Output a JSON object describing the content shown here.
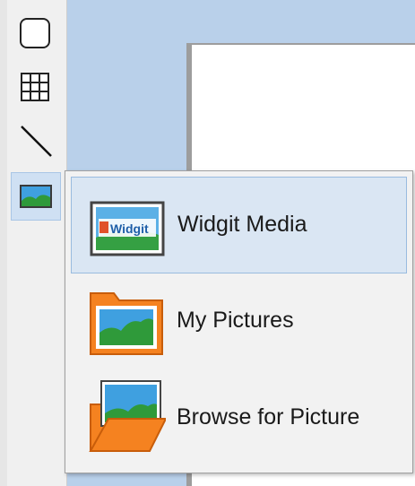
{
  "window": {
    "title": ""
  },
  "toolbar": {
    "tools": [
      {
        "name": "rounded-rectangle",
        "icon": "rounded-square-icon"
      },
      {
        "name": "table",
        "icon": "grid-icon"
      },
      {
        "name": "line",
        "icon": "line-icon"
      },
      {
        "name": "picture",
        "icon": "picture-icon",
        "selected": true
      }
    ]
  },
  "popup": {
    "items": [
      {
        "label": "Widgit Media",
        "icon": "widgit-media-icon",
        "badge": "Widgit",
        "highlighted": true
      },
      {
        "label": "My Pictures",
        "icon": "folder-picture-icon",
        "highlighted": false
      },
      {
        "label": "Browse for Picture",
        "icon": "open-folder-picture-icon",
        "highlighted": false
      }
    ]
  },
  "colors": {
    "canvas_background": "#b9d0ea",
    "menu_highlight": "#dae6f3",
    "folder_orange": "#f58220",
    "sky_blue": "#3fa0e0",
    "grass_green": "#2f9a3a"
  }
}
